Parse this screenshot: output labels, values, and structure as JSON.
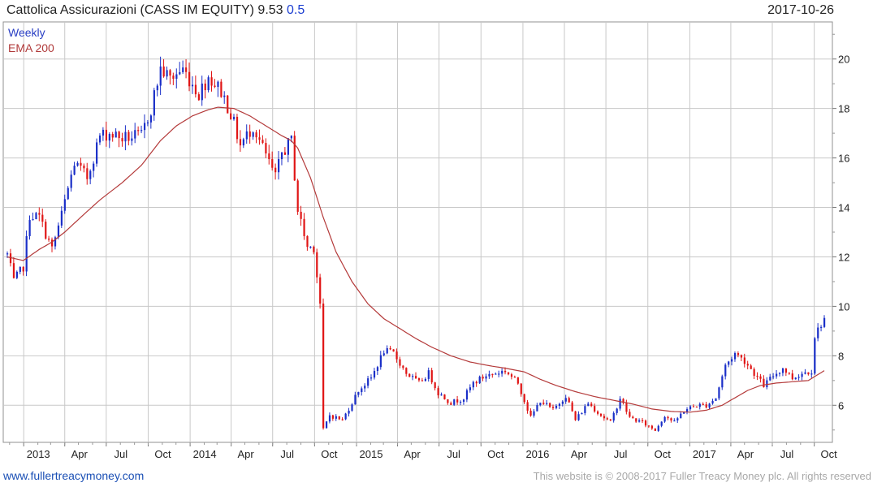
{
  "header": {
    "title": "Cattolica Assicurazioni (CASS IM EQUITY) 9.53",
    "change": "0.5",
    "date": "2017-10-26"
  },
  "legend": {
    "series1": "Weekly",
    "series2": "EMA 200"
  },
  "footer": {
    "site": "www.fullertreacymoney.com",
    "copyright": "This website is © 2008-2017 Fuller Treacy Money plc. All rights reserved"
  },
  "colors": {
    "up": "#1a2fc8",
    "down": "#e01515",
    "ema": "#b43a3a",
    "grid": "#c8c8c8"
  },
  "chart_data": {
    "type": "candlestick",
    "x_tick_labels": [
      "2013",
      "Apr",
      "Jul",
      "Oct",
      "2014",
      "Apr",
      "Jul",
      "Oct",
      "2015",
      "Apr",
      "Jul",
      "Oct",
      "2016",
      "Apr",
      "Jul",
      "Oct",
      "2017",
      "Apr",
      "Jul",
      "Oct"
    ],
    "y_ticks": [
      6,
      8,
      10,
      12,
      14,
      16,
      18,
      20
    ],
    "ylim": [
      4.5,
      21.5
    ],
    "anchors": [
      [
        "2012-11-26",
        12.1
      ],
      [
        "2012-12-10",
        11.0
      ],
      [
        "2012-12-31",
        11.6
      ],
      [
        "2013-01-14",
        13.7
      ],
      [
        "2013-02-04",
        13.6
      ],
      [
        "2013-03-04",
        12.3
      ],
      [
        "2013-03-25",
        13.7
      ],
      [
        "2013-04-22",
        15.8
      ],
      [
        "2013-05-20",
        15.2
      ],
      [
        "2013-06-17",
        16.9
      ],
      [
        "2013-07-08",
        17.0
      ],
      [
        "2013-08-05",
        16.8
      ],
      [
        "2013-09-16",
        16.9
      ],
      [
        "2013-10-07",
        18.0
      ],
      [
        "2013-10-28",
        19.6
      ],
      [
        "2013-11-18",
        19.2
      ],
      [
        "2013-12-16",
        19.6
      ],
      [
        "2014-01-20",
        18.6
      ],
      [
        "2014-02-10",
        19.3
      ],
      [
        "2014-03-10",
        18.7
      ],
      [
        "2014-03-31",
        17.8
      ],
      [
        "2014-04-21",
        16.5
      ],
      [
        "2014-05-19",
        17.3
      ],
      [
        "2014-06-16",
        16.1
      ],
      [
        "2014-07-07",
        15.2
      ],
      [
        "2014-07-21",
        16.2
      ],
      [
        "2014-08-11",
        16.7
      ],
      [
        "2014-08-25",
        13.9
      ],
      [
        "2014-09-15",
        12.4
      ],
      [
        "2014-09-29",
        12.4
      ],
      [
        "2014-10-13",
        10.1
      ],
      [
        "2014-10-20",
        5.0
      ],
      [
        "2014-11-03",
        5.6
      ],
      [
        "2014-12-01",
        5.4
      ],
      [
        "2015-01-05",
        6.6
      ],
      [
        "2015-02-02",
        7.1
      ],
      [
        "2015-03-02",
        8.2
      ],
      [
        "2015-03-23",
        8.1
      ],
      [
        "2015-04-20",
        7.3
      ],
      [
        "2015-05-18",
        6.9
      ],
      [
        "2015-06-08",
        7.3
      ],
      [
        "2015-06-29",
        6.5
      ],
      [
        "2015-07-27",
        6.1
      ],
      [
        "2015-08-24",
        6.3
      ],
      [
        "2015-09-14",
        6.9
      ],
      [
        "2015-10-12",
        7.2
      ],
      [
        "2015-11-02",
        7.3
      ],
      [
        "2015-11-23",
        7.4
      ],
      [
        "2015-12-21",
        6.9
      ],
      [
        "2016-01-18",
        5.5
      ],
      [
        "2016-02-08",
        6.2
      ],
      [
        "2016-03-07",
        5.8
      ],
      [
        "2016-04-04",
        6.4
      ],
      [
        "2016-04-25",
        5.4
      ],
      [
        "2016-05-23",
        6.1
      ],
      [
        "2016-06-20",
        5.6
      ],
      [
        "2016-07-11",
        5.3
      ],
      [
        "2016-08-01",
        6.3
      ],
      [
        "2016-08-22",
        5.5
      ],
      [
        "2016-09-19",
        5.3
      ],
      [
        "2016-10-17",
        5.0
      ],
      [
        "2016-11-07",
        5.6
      ],
      [
        "2016-11-28",
        5.3
      ],
      [
        "2016-12-19",
        5.8
      ],
      [
        "2017-01-16",
        6.0
      ],
      [
        "2017-02-06",
        6.0
      ],
      [
        "2017-02-27",
        6.3
      ],
      [
        "2017-03-20",
        7.6
      ],
      [
        "2017-04-10",
        8.1
      ],
      [
        "2017-05-01",
        7.8
      ],
      [
        "2017-05-22",
        7.3
      ],
      [
        "2017-06-12",
        6.8
      ],
      [
        "2017-07-03",
        7.2
      ],
      [
        "2017-07-24",
        7.5
      ],
      [
        "2017-08-14",
        7.1
      ],
      [
        "2017-09-04",
        7.3
      ],
      [
        "2017-09-25",
        7.4
      ],
      [
        "2017-10-02",
        8.8
      ],
      [
        "2017-10-16",
        9.3
      ],
      [
        "2017-10-23",
        9.53
      ]
    ],
    "ema_anchors": [
      [
        "2012-11-26",
        12.0
      ],
      [
        "2012-12-31",
        11.85
      ],
      [
        "2013-02-04",
        12.3
      ],
      [
        "2013-03-04",
        12.6
      ],
      [
        "2013-04-01",
        13.0
      ],
      [
        "2013-05-06",
        13.6
      ],
      [
        "2013-06-17",
        14.3
      ],
      [
        "2013-08-05",
        15.0
      ],
      [
        "2013-09-16",
        15.7
      ],
      [
        "2013-10-28",
        16.7
      ],
      [
        "2013-12-02",
        17.3
      ],
      [
        "2014-01-06",
        17.7
      ],
      [
        "2014-02-10",
        17.95
      ],
      [
        "2014-03-03",
        18.05
      ],
      [
        "2014-04-07",
        18.0
      ],
      [
        "2014-05-12",
        17.7
      ],
      [
        "2014-06-16",
        17.3
      ],
      [
        "2014-07-21",
        16.9
      ],
      [
        "2014-08-11",
        16.7
      ],
      [
        "2014-08-25",
        16.4
      ],
      [
        "2014-09-22",
        15.2
      ],
      [
        "2014-10-20",
        13.6
      ],
      [
        "2014-11-17",
        12.2
      ],
      [
        "2014-12-22",
        11.0
      ],
      [
        "2015-01-26",
        10.1
      ],
      [
        "2015-03-02",
        9.5
      ],
      [
        "2015-04-06",
        9.1
      ],
      [
        "2015-05-11",
        8.7
      ],
      [
        "2015-06-15",
        8.35
      ],
      [
        "2015-07-27",
        8.0
      ],
      [
        "2015-09-07",
        7.75
      ],
      [
        "2015-10-19",
        7.6
      ],
      [
        "2015-11-23",
        7.5
      ],
      [
        "2016-01-04",
        7.35
      ],
      [
        "2016-02-08",
        7.05
      ],
      [
        "2016-03-14",
        6.8
      ],
      [
        "2016-04-25",
        6.55
      ],
      [
        "2016-06-06",
        6.35
      ],
      [
        "2016-07-18",
        6.2
      ],
      [
        "2016-08-29",
        6.05
      ],
      [
        "2016-10-10",
        5.85
      ],
      [
        "2016-11-21",
        5.75
      ],
      [
        "2017-01-02",
        5.72
      ],
      [
        "2017-02-06",
        5.8
      ],
      [
        "2017-03-13",
        6.0
      ],
      [
        "2017-04-10",
        6.3
      ],
      [
        "2017-05-08",
        6.6
      ],
      [
        "2017-06-05",
        6.8
      ],
      [
        "2017-07-10",
        6.9
      ],
      [
        "2017-08-14",
        6.95
      ],
      [
        "2017-09-18",
        7.0
      ],
      [
        "2017-10-23",
        7.4
      ]
    ]
  }
}
